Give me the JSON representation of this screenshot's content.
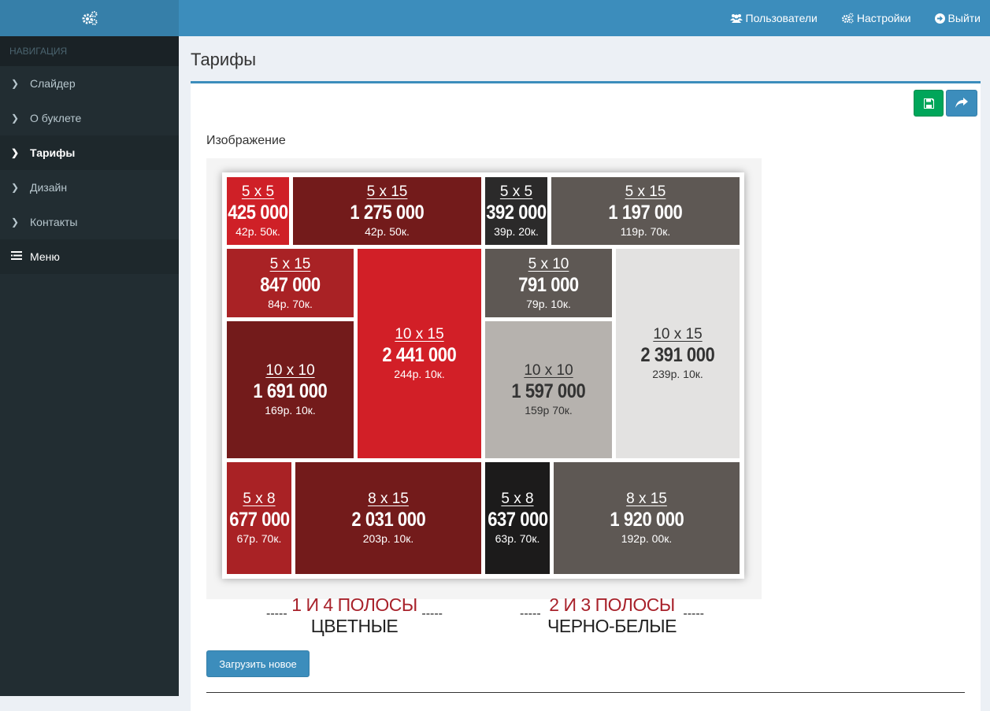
{
  "sidebar": {
    "header": "НАВИГАЦИЯ",
    "items": [
      {
        "label": "Слайдер"
      },
      {
        "label": "О буклете"
      },
      {
        "label": "Тарифы"
      },
      {
        "label": "Дизайн"
      },
      {
        "label": "Контакты"
      },
      {
        "label": "Меню"
      }
    ]
  },
  "topnav": {
    "users": "Пользователи",
    "settings": "Настройки",
    "logout": "Выйти"
  },
  "page": {
    "title": "Тарифы",
    "image_label": "Изображение",
    "upload_button": "Загрузить новое"
  },
  "tariff_image": {
    "tiles": [
      {
        "size": "5 x 5",
        "price": "425 000",
        "sub": "42р. 50к.",
        "color": "#cf2027"
      },
      {
        "size": "5 x 15",
        "price": "1 275 000",
        "sub": "42р. 50к.",
        "color": "#731b1b"
      },
      {
        "size": "5 x 5",
        "price": "392 000",
        "sub": "39р. 20к.",
        "color": "#2b2a2a"
      },
      {
        "size": "5 x 15",
        "price": "1 197 000",
        "sub": "119р. 70к.",
        "color": "#5e5854"
      },
      {
        "size": "5 x 15",
        "price": "847 000",
        "sub": "84р. 70к.",
        "color": "#a92225"
      },
      {
        "size": "10 x 15",
        "price": "2 441 000",
        "sub": "244р. 10к.",
        "color": "#d21f27"
      },
      {
        "size": "5 x 10",
        "price": "791 000",
        "sub": "79р. 10к.",
        "color": "#5e5854"
      },
      {
        "size": "10 x 15",
        "price": "2 391 000",
        "sub": "239р. 10к.",
        "color": "#e3e2e1"
      },
      {
        "size": "10 x 10",
        "price": "1 691 000",
        "sub": "169р. 10к.",
        "color": "#731b1b"
      },
      {
        "size": "10 x 10",
        "price": "1 597 000",
        "sub": "159р 70к.",
        "color": "#b6b2ae"
      },
      {
        "size": "5 x 8",
        "price": "677 000",
        "sub": "67р. 70к.",
        "color": "#a92225"
      },
      {
        "size": "8 x 15",
        "price": "2 031 000",
        "sub": "203р. 10к.",
        "color": "#731b1b"
      },
      {
        "size": "5 x 8",
        "price": "637 000",
        "sub": "63р. 70к.",
        "color": "#1c1b1b"
      },
      {
        "size": "8 x 15",
        "price": "1 920 000",
        "sub": "192р. 00к.",
        "color": "#5e5854"
      }
    ],
    "captions": [
      {
        "title": "1 И 4 ПОЛОСЫ",
        "subtitle": "ЦВЕТНЫЕ",
        "dash": "-----"
      },
      {
        "title": "2 И 3 ПОЛОСЫ",
        "subtitle": "ЧЕРНО-БЕЛЫЕ",
        "dash": "-----"
      }
    ]
  },
  "colors": {
    "accent": "#3c8dbc",
    "success": "#00a65a",
    "sidebar_bg": "#222d32"
  }
}
